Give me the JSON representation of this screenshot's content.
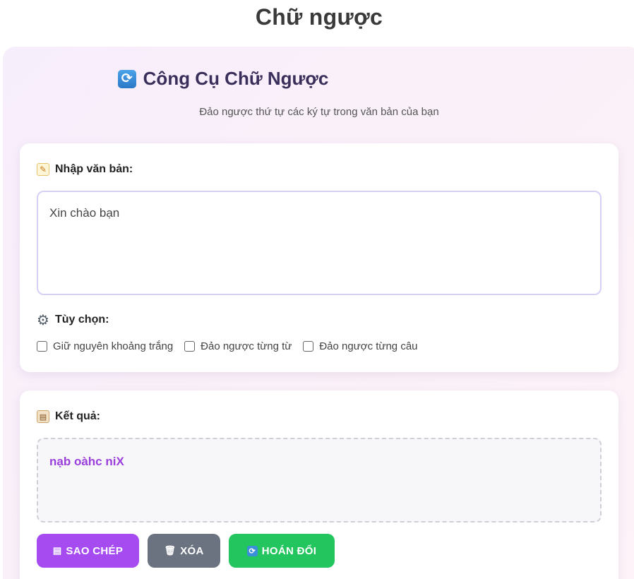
{
  "page": {
    "title": "Chữ ngược"
  },
  "header": {
    "icon": "refresh-icon",
    "title": "Công Cụ Chữ Ngược",
    "subtitle": "Đảo ngược thứ tự các ký tự trong văn bản của bạn"
  },
  "input_section": {
    "label": "Nhập văn bản:",
    "label_icon": "memo-icon",
    "value": "Xin chào bạn"
  },
  "options": {
    "label": "Tùy chọn:",
    "label_icon": "gear-icon",
    "items": [
      {
        "label": "Giữ nguyên khoảng trắng",
        "checked": false
      },
      {
        "label": "Đảo ngược từng từ",
        "checked": false
      },
      {
        "label": "Đảo ngược từng câu",
        "checked": false
      }
    ]
  },
  "result_section": {
    "label": "Kết quả:",
    "label_icon": "clipboard-icon",
    "value": "nạb oàhc niX"
  },
  "buttons": {
    "copy": "SAO CHÉP",
    "clear": "XÓA",
    "swap": "HOÁN ĐỔI"
  },
  "colors": {
    "accent_purple": "#a54bf0",
    "clear_gray": "#6b7280",
    "swap_green": "#22c55e",
    "result_text": "#9b3fdc"
  }
}
